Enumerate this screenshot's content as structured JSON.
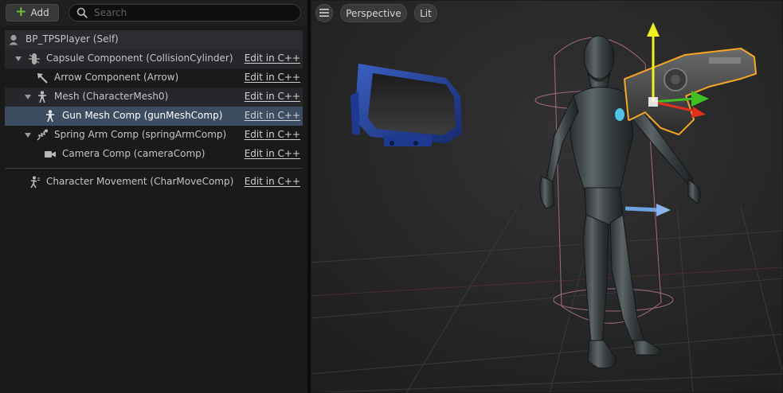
{
  "toolbar": {
    "add_label": "Add",
    "search_placeholder": "Search"
  },
  "tree": {
    "root": "BP_TPSPlayer (Self)",
    "edit_label": "Edit in C++",
    "items": [
      {
        "label": "Capsule Component (CollisionCylinder)",
        "icon": "capsule-icon"
      },
      {
        "label": "Arrow Component (Arrow)",
        "icon": "arrow-component-icon"
      },
      {
        "label": "Mesh (CharacterMesh0)",
        "icon": "skeletal-mesh-icon"
      },
      {
        "label": "Gun Mesh Comp (gunMeshComp)",
        "icon": "skeletal-mesh-icon",
        "selected": true
      },
      {
        "label": "Spring Arm Comp (springArmComp)",
        "icon": "spring-arm-icon"
      },
      {
        "label": "Camera Comp (cameraComp)",
        "icon": "camera-icon"
      },
      {
        "label": "Character Movement (CharMoveComp)",
        "icon": "character-movement-icon"
      }
    ]
  },
  "viewport": {
    "menu_icon": "hamburger-icon",
    "view_mode": "Perspective",
    "lighting_mode": "Lit"
  },
  "colors": {
    "selection": "#3c4c61",
    "selection_outline": "#f5a623",
    "gizmo_x": "#e03020",
    "gizmo_y": "#40c020",
    "gizmo_z": "#f0f020",
    "add_plus": "#70c040"
  }
}
